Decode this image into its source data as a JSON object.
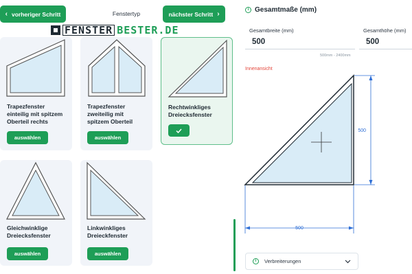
{
  "header": {
    "prev_label": "vorheriger Schritt",
    "next_label": "nächster Schritt",
    "step_title": "Fenstertyp"
  },
  "logo": {
    "part1": "FENSTER",
    "part2": "BESTER.DE"
  },
  "cards": [
    {
      "title_lines": [
        "Trapezfenster",
        "einteilig mit spitzem",
        "Oberteil rechts"
      ],
      "button": "auswählen",
      "selected": false
    },
    {
      "title_lines": [
        "Trapezfenster",
        "zweiteilig mit",
        "spitzem Oberteil"
      ],
      "button": "auswählen",
      "selected": false
    },
    {
      "title_lines": [
        "Rechtwinkliges",
        "Dreiecksfenster"
      ],
      "button": "✓",
      "selected": true
    },
    {
      "title_lines": [
        "Gleichwinklige",
        "Dreiecksfenster"
      ],
      "button": "auswählen",
      "selected": false
    },
    {
      "title_lines": [
        "Linkwinkliges",
        "Dreieckfenster"
      ],
      "button": "auswählen",
      "selected": false
    }
  ],
  "panel": {
    "title": "Gesamtmaße (mm)",
    "width_label": "Gesamtbreite (mm)",
    "width_value": "500",
    "height_label": "Gesamthöhe (mm)",
    "height_value": "500",
    "range_hint": "500mm - 2400mm",
    "view_label": "Innenansicht",
    "dim_height": "500",
    "dim_width": "500",
    "accordion_label": "Verbreiterungen"
  },
  "colors": {
    "accent": "#1e9e57",
    "glass": "#d9ecf7",
    "dimension": "#2f6fd6",
    "warning": "#e3453a"
  },
  "icons": [
    "chevron-left-icon",
    "chevron-right-icon",
    "check-icon",
    "info-icon",
    "chevron-down-icon"
  ]
}
